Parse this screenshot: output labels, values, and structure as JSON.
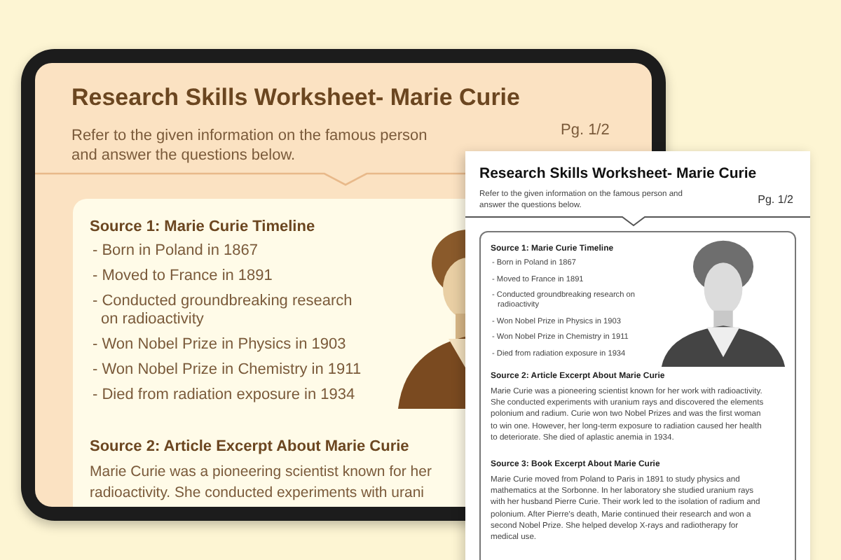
{
  "tablet": {
    "title": "Research Skills Worksheet- Marie Curie",
    "instructions": "Refer to the given information on the famous person and answer the questions below.",
    "page": "Pg. 1/2",
    "sources": [
      {
        "kind": "list",
        "heading": "Source 1: Marie Curie Timeline",
        "items": [
          "- Born in Poland in 1867",
          "- Moved to France in 1891",
          "- Conducted groundbreaking research on radioactivity",
          "- Won Nobel Prize in Physics in 1903",
          "- Won Nobel Prize in Chemistry in 1911",
          "- Died from radiation exposure in 1934"
        ]
      },
      {
        "kind": "lines",
        "heading": "Source 2: Article Excerpt About Marie Curie",
        "lines": [
          "Marie Curie was a pioneering scientist known for her",
          "radioactivity. She conducted experiments with urani"
        ]
      }
    ]
  },
  "worksheet": {
    "title": "Research Skills Worksheet- Marie Curie",
    "instructions": "Refer to the given information on the famous person and answer the questions below.",
    "page": "Pg. 1/2",
    "sources": [
      {
        "kind": "list",
        "heading": "Source 1: Marie Curie Timeline",
        "items": [
          "- Born in Poland in 1867",
          "- Moved to France in 1891",
          "- Conducted groundbreaking research on radioactivity",
          "- Won Nobel Prize in Physics in 1903",
          "- Won Nobel Prize in Chemistry in 1911",
          "- Died from radiation exposure in 1934"
        ]
      },
      {
        "kind": "text",
        "heading": "Source 2: Article Excerpt About Marie Curie",
        "text": "Marie Curie was a pioneering scientist known for her work with radioactivity. She conducted experiments with uranium rays and discovered the elements polonium and radium. Curie won two Nobel Prizes and was the first woman to win one. However, her long-term exposure to radiation caused her health to deteriorate. She died of aplastic anemia in 1934."
      },
      {
        "kind": "text",
        "heading": "Source 3: Book Excerpt About Marie Curie",
        "text": "Marie Curie moved from Poland to Paris in 1891 to study physics and mathematics at the Sorbonne. In her laboratory she studied uranium rays with her husband Pierre Curie. Their work led to the isolation of radium and polonium. After Pierre's death, Marie continued their research and won a second Nobel Prize. She helped develop X-rays and radiotherapy for medical use."
      }
    ]
  }
}
